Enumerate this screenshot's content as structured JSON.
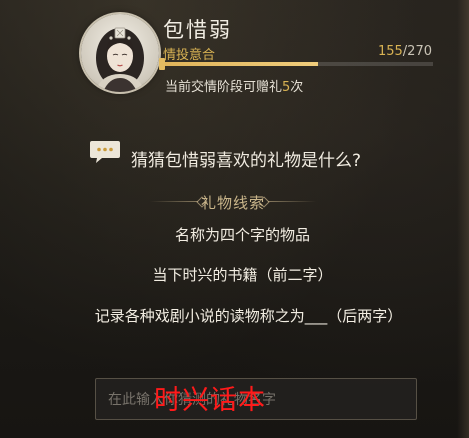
{
  "character": {
    "name": "包惜弱",
    "relation_label": "情投意合",
    "progress_current": "155",
    "progress_sep": "/",
    "progress_max": "270",
    "progress_fraction": 0.574,
    "stage_note_prefix": "当前交情阶段可赠礼",
    "stage_note_count": "5",
    "stage_note_suffix": "次"
  },
  "question": {
    "text": "猜猜包惜弱喜欢的礼物是什么?",
    "icon": "speech-bubble-icon"
  },
  "hints": {
    "title": "礼物线索",
    "clues": [
      "名称为四个字的物品",
      "当下时兴的书籍（前二字）",
      "记录各种戏剧小说的读物称之为___（后两字）"
    ]
  },
  "answer_input": {
    "placeholder": "在此输入你猜测的礼物名字",
    "value": ""
  },
  "overlay": {
    "text": "时兴话本"
  },
  "colors": {
    "accent_gold": "#d8b253",
    "overlay_red": "#ff1a1a"
  }
}
